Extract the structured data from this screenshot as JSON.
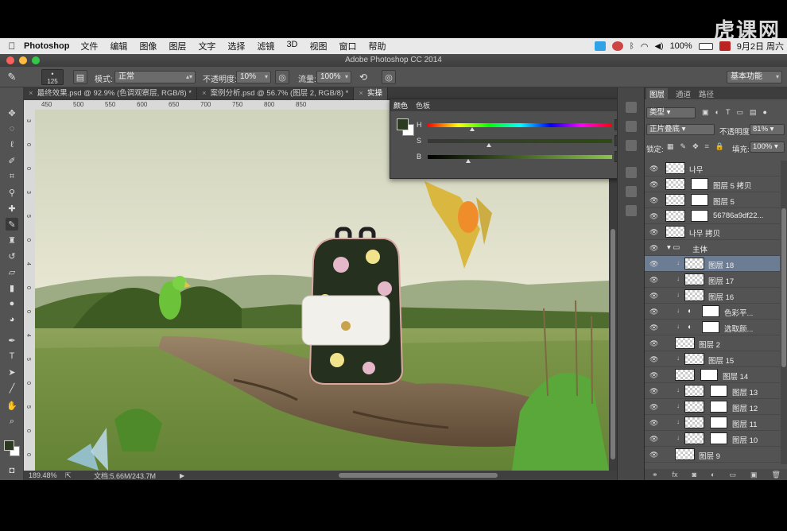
{
  "menubar": {
    "app": "Photoshop",
    "items": [
      "文件",
      "编辑",
      "图像",
      "图层",
      "文字",
      "选择",
      "滤镜",
      "3D",
      "视图",
      "窗口",
      "帮助"
    ],
    "battery": "100%",
    "date": "9月2日 周六"
  },
  "watermark": "虎课网",
  "window": {
    "title": "Adobe Photoshop CC 2014"
  },
  "options": {
    "brush_size": "125",
    "mode_label": "模式:",
    "mode_value": "正常",
    "opacity_label": "不透明度:",
    "opacity_value": "10%",
    "flow_label": "流量:",
    "flow_value": "100%",
    "workspace": "基本功能"
  },
  "tabs": [
    {
      "label": "最终效果.psd @ 92.9% (色调观察层, RGB/8) *"
    },
    {
      "label": "案例分析.psd @ 56.7% (图层 2, RGB/8) *"
    },
    {
      "label": "实操"
    }
  ],
  "ruler": {
    "h_ticks": [
      "450",
      "500",
      "550",
      "600",
      "650",
      "700",
      "750",
      "800",
      "850"
    ],
    "v_ticks": [
      "3",
      "0",
      "0",
      "3",
      "5",
      "0",
      "4",
      "0",
      "0",
      "4",
      "5",
      "0",
      "5",
      "0",
      "0"
    ]
  },
  "color_panel": {
    "tabs": [
      "颜色",
      "色板"
    ],
    "fg_color": "#2d3a22",
    "h": {
      "label": "H",
      "value": "88",
      "unit": "°",
      "pos": 0.24
    },
    "s": {
      "label": "S",
      "value": "33",
      "unit": "%",
      "pos": 0.33
    },
    "b": {
      "label": "B",
      "value": "22",
      "unit": "%",
      "pos": 0.22
    }
  },
  "status": {
    "zoom": "189.48%",
    "doc": "文档:5.66M/243.7M"
  },
  "layers_panel": {
    "tabs": [
      "图层",
      "通道",
      "路径"
    ],
    "kind": "类型",
    "blend": "正片叠底",
    "opacity_label": "不透明度:",
    "opacity": "81%",
    "lock_label": "锁定:",
    "fill_label": "填充:",
    "fill": "100%",
    "layers": [
      {
        "name": "나무",
        "sel": false,
        "mask": false,
        "clip": false,
        "indent": 0
      },
      {
        "name": "图层 5 拷贝",
        "sel": false,
        "mask": true,
        "clip": false,
        "indent": 0
      },
      {
        "name": "图层 5",
        "sel": false,
        "mask": true,
        "clip": false,
        "indent": 0
      },
      {
        "name": "56786a9df22...",
        "sel": false,
        "mask": true,
        "clip": false,
        "indent": 0
      },
      {
        "name": "나무 拷贝",
        "sel": false,
        "mask": false,
        "clip": false,
        "indent": 0
      },
      {
        "name": "主体",
        "sel": false,
        "mask": false,
        "clip": false,
        "indent": 0,
        "group": true
      },
      {
        "name": "图层 18",
        "sel": true,
        "mask": false,
        "clip": true,
        "indent": 1
      },
      {
        "name": "图层 17",
        "sel": false,
        "mask": false,
        "clip": true,
        "indent": 1
      },
      {
        "name": "图层 16",
        "sel": false,
        "mask": false,
        "clip": true,
        "indent": 1
      },
      {
        "name": "色彩平...",
        "sel": false,
        "mask": true,
        "clip": true,
        "indent": 1,
        "adj": true
      },
      {
        "name": "选取颜...",
        "sel": false,
        "mask": true,
        "clip": true,
        "indent": 1,
        "adj": true
      },
      {
        "name": "图层 2",
        "sel": false,
        "mask": false,
        "clip": false,
        "indent": 1
      },
      {
        "name": "图层 15",
        "sel": false,
        "mask": false,
        "clip": true,
        "indent": 1
      },
      {
        "name": "图层 14",
        "sel": false,
        "mask": true,
        "clip": false,
        "indent": 1
      },
      {
        "name": "图层 13",
        "sel": false,
        "mask": true,
        "clip": true,
        "indent": 1
      },
      {
        "name": "图层 12",
        "sel": false,
        "mask": true,
        "clip": true,
        "indent": 1
      },
      {
        "name": "图层 11",
        "sel": false,
        "mask": true,
        "clip": true,
        "indent": 1
      },
      {
        "name": "图层 10",
        "sel": false,
        "mask": true,
        "clip": true,
        "indent": 1
      },
      {
        "name": "图层 9",
        "sel": false,
        "mask": false,
        "clip": false,
        "indent": 1
      }
    ]
  }
}
